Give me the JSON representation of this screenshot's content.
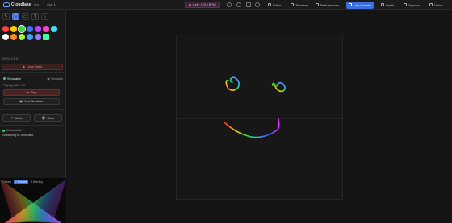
{
  "app": {
    "name": "Cloudlase",
    "sub": "labs",
    "project": "Cue 1"
  },
  "live": {
    "label": "Live · 120.0 BPM"
  },
  "nav": [
    {
      "label": "Editor",
      "icon": "gear-icon"
    },
    {
      "label": "Timeline",
      "icon": "timeline-icon"
    },
    {
      "label": "Performance",
      "icon": "grid-icon"
    },
    {
      "label": "Live Canvas",
      "icon": "pencil-icon",
      "active": true
    },
    {
      "label": "Synth",
      "icon": "wave-icon"
    },
    {
      "label": "Spectra",
      "icon": "spectrum-icon"
    },
    {
      "label": "Vision",
      "icon": "eye-icon"
    }
  ],
  "tools": [
    {
      "glyph": "✎",
      "icon": "pencil-tool-icon"
    },
    {
      "glyph": "◯",
      "icon": "circle-tool-icon",
      "active": true
    },
    {
      "glyph": "▭",
      "icon": "rectangle-tool-icon"
    },
    {
      "glyph": "T",
      "icon": "text-tool-icon"
    },
    {
      "glyph": "⌂",
      "icon": "shape-tool-icon"
    }
  ],
  "colors": [
    "#ff4040",
    "#ffd000",
    "#3fd44a",
    "#3b6fff",
    "#c040ff",
    "#ff40c8",
    "#40e0ff",
    "#ffffff",
    "#ff8a20",
    "#a0ff40",
    "#40a0ff",
    "#9a7cff",
    "#40ff9a"
  ],
  "devices": {
    "title": "DEVICES",
    "learn_label": "Learn Ilmed",
    "device_name": "Simulator",
    "device_type": "Simulator",
    "info": "Playing | 562 / 3K",
    "stop_label": "Stop",
    "view_label": "View Simulator"
  },
  "actions": {
    "undo": "Undo",
    "clear": "Clear"
  },
  "status": {
    "line1": "Connected",
    "line2": "Streaming to Simulator"
  },
  "preview": {
    "tabs": [
      "3 Beam",
      "2 Ambient",
      "3 Warning"
    ]
  }
}
